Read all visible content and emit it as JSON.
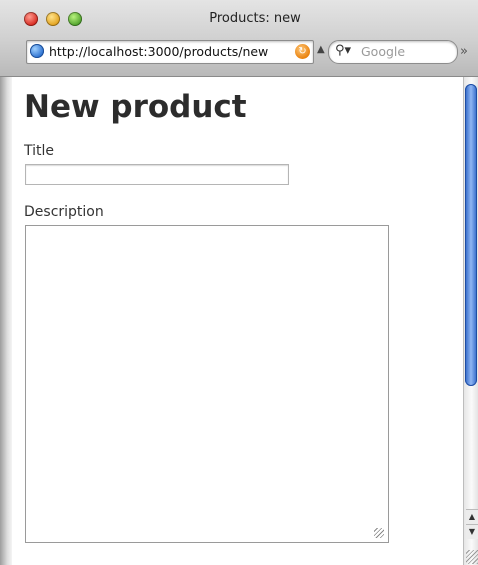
{
  "window": {
    "title": "Products: new"
  },
  "toolbar": {
    "url": "http://localhost:3000/products/new",
    "search_placeholder": "Google"
  },
  "page": {
    "heading": "New product",
    "fields": {
      "title_label": "Title",
      "title_value": "",
      "description_label": "Description",
      "description_value": ""
    }
  },
  "icons": {
    "url": "globe-icon",
    "reload": "reload-icon",
    "search": "search-icon",
    "overflow": "chevron-double-right-icon"
  },
  "colors": {
    "scroll_thumb": "#2e63c4",
    "reload": "#e9820e"
  }
}
